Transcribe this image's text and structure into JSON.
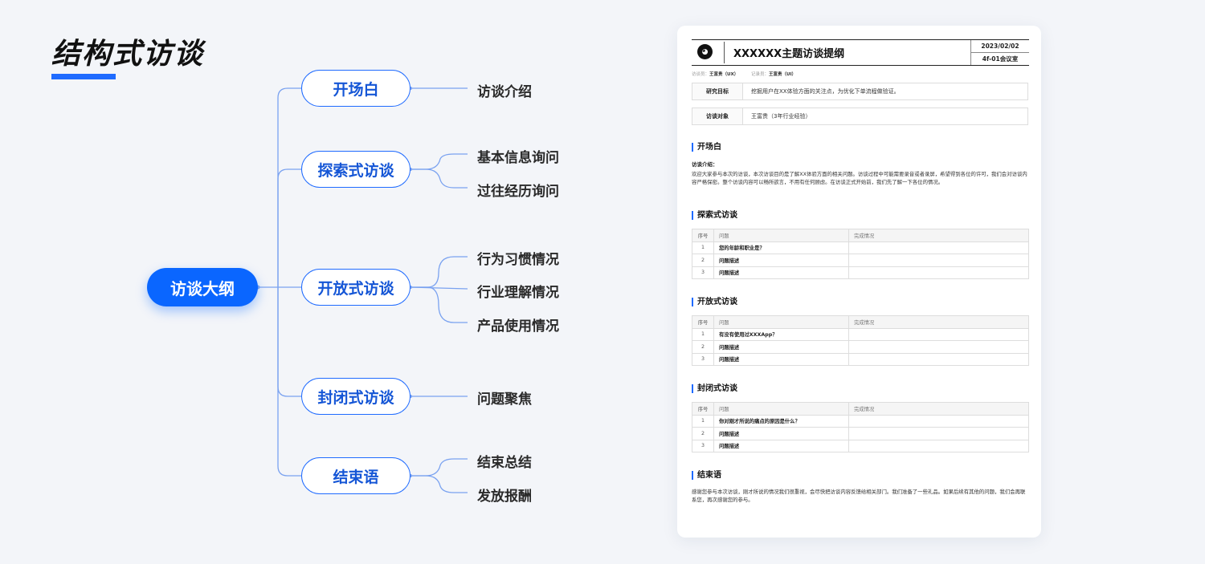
{
  "title": "结构式访谈",
  "mindmap": {
    "root": "访谈大纲",
    "branches": [
      {
        "label": "开场白",
        "leaves": [
          "访谈介绍"
        ]
      },
      {
        "label": "探索式访谈",
        "leaves": [
          "基本信息询问",
          "过往经历询问"
        ]
      },
      {
        "label": "开放式访谈",
        "leaves": [
          "行为习惯情况",
          "行业理解情况",
          "产品使用情况"
        ]
      },
      {
        "label": "封闭式访谈",
        "leaves": [
          "问题聚焦"
        ]
      },
      {
        "label": "结束语",
        "leaves": [
          "结束总结",
          "发放报酬"
        ]
      }
    ]
  },
  "doc": {
    "logo_glyph": "◕",
    "title": "XXXXXX主题访谈提纲",
    "date": "2023/02/02",
    "room": "4f-01会议室",
    "interviewer_label": "访谈员：",
    "interviewer": "王富贵（UX）",
    "recorder_label": "记录员：",
    "recorder": "王富贵（UI）",
    "goal_label": "研究目标",
    "goal": "挖掘用户在XX体验方面的关注点，为优化下单流程做验证。",
    "target_label": "访谈对象",
    "target": "王富贵（3年行业经验）",
    "opening": {
      "title": "开场白",
      "sub": "访谈介绍：",
      "text": "欢迎大家参与本次的访谈，本次访谈目的是了解XX体验方面的相关问题。访谈过程中可能需要录音或者录屏，希望得到各位的许可，我们会对访谈内容严格保密。整个访谈内容可以畅所欲言，不用有任何顾虑。在访谈正式开始前，我们先了解一下各位的情况。"
    },
    "table_headers": {
      "num": "序号",
      "question": "问题",
      "status": "完成情况"
    },
    "explore": {
      "title": "探索式访谈",
      "rows": [
        {
          "num": "1",
          "q": "您的年龄和职业是？"
        },
        {
          "num": "2",
          "q": "问题描述"
        },
        {
          "num": "3",
          "q": "问题描述"
        }
      ]
    },
    "open": {
      "title": "开放式访谈",
      "rows": [
        {
          "num": "1",
          "q": "有没有使用过XXXApp？"
        },
        {
          "num": "2",
          "q": "问题描述"
        },
        {
          "num": "3",
          "q": "问题描述"
        }
      ]
    },
    "closed": {
      "title": "封闭式访谈",
      "rows": [
        {
          "num": "1",
          "q": "你对刚才所说的痛点的原因是什么？"
        },
        {
          "num": "2",
          "q": "问题描述"
        },
        {
          "num": "3",
          "q": "问题描述"
        }
      ]
    },
    "ending": {
      "title": "结束语",
      "text": "感谢您参与本次访谈，刚才所说的情况我们很重视，会尽快把访谈内容反馈给相关部门。我们准备了一些礼品。如果后续有其他的问题，我们会再联系您，再次感谢您的参与。"
    }
  }
}
